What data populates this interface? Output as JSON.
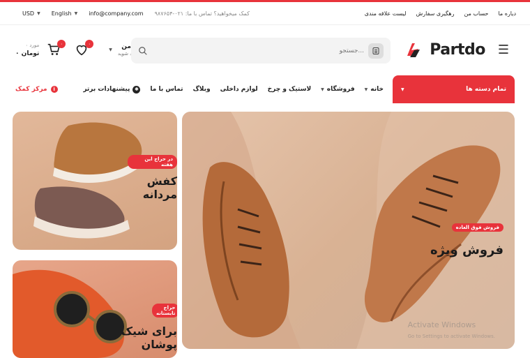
{
  "topbar": {
    "currency": "USD",
    "language": "English",
    "email": "info@company.com",
    "help_text": "کمک میخواهید؟ تماس با ما: ۰۲۱-۹۸۷۶۵۴",
    "links": [
      "دیاره ما",
      "حساب من",
      "رهگیری سفارش",
      "لیست علاقه مندی"
    ]
  },
  "header": {
    "cart_count": "۰",
    "cart_items": "۰ مورد",
    "cart_total": "۰ تومان",
    "wishlist_count": "۰",
    "account_title": "حساب من",
    "account_sub": "سلام , وارد شوید",
    "search_placeholder": "جستجو...",
    "logo": "Partdo"
  },
  "nav": {
    "help": "مرکز کمک",
    "items": [
      "خانه",
      "فروشگاه",
      "لاستیک و چرخ",
      "لوازم داخلی",
      "وبلاگ",
      "تماس با ما",
      "پیشنهادات برتر"
    ],
    "all_categories": "تمام دسته ها"
  },
  "banners": {
    "big": {
      "tag": "فروش فوق العاده",
      "title": "فروش ویژه"
    },
    "small1": {
      "tag": "در حراج این هفته",
      "title": "کفش مردانه"
    },
    "small2": {
      "tag": "حراج تابستانه",
      "title": "برای شیک پوشان"
    }
  },
  "watermark": {
    "line1": "Activate Windows",
    "line2": "Go to Settings to activate Windows."
  },
  "colors": {
    "accent": "#e8333b"
  }
}
